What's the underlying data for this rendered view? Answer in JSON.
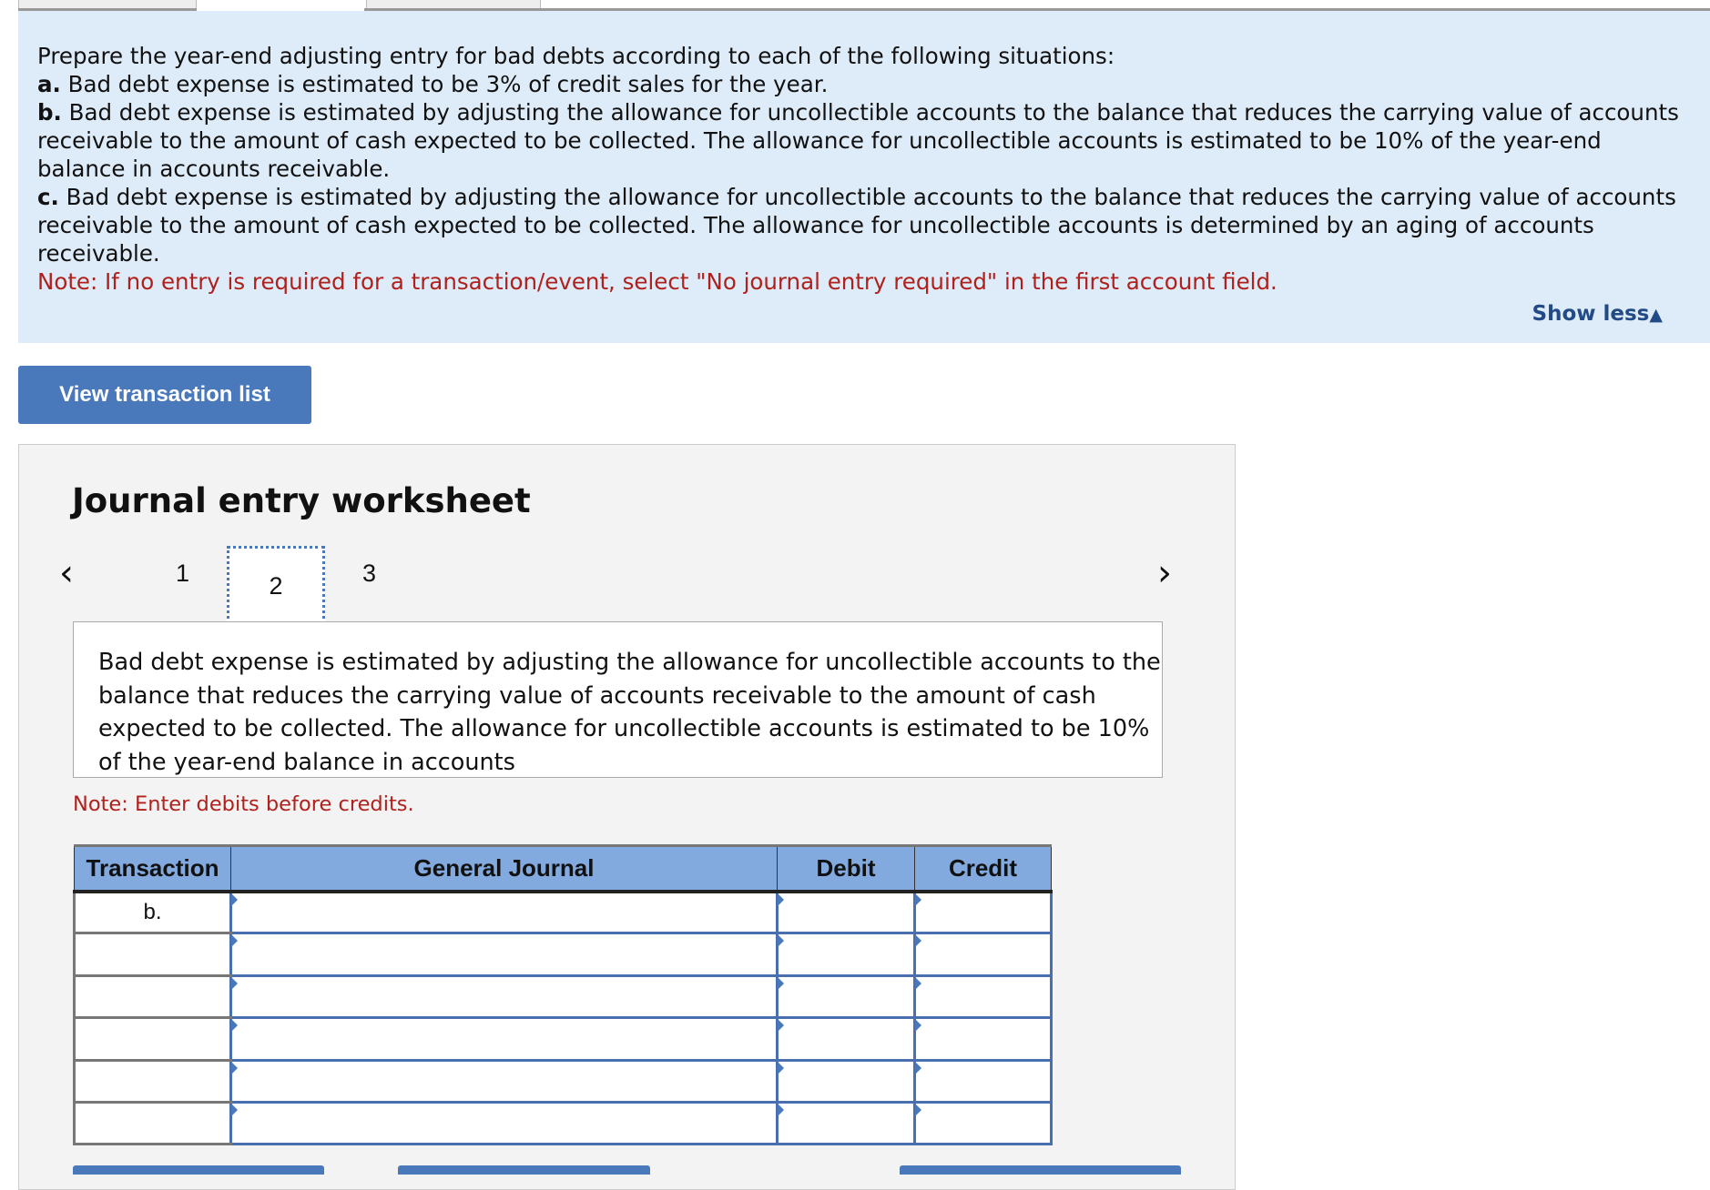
{
  "instructions": {
    "intro": "Prepare the year-end adjusting entry for bad debts according to each of the following situations:",
    "items": [
      {
        "label": "a.",
        "text": " Bad debt expense is estimated to be 3% of credit sales for the year."
      },
      {
        "label": "b.",
        "text": " Bad debt expense is estimated by adjusting the allowance for uncollectible accounts to the balance that reduces the carrying value of accounts receivable to the amount of cash expected to be collected. The allowance for uncollectible accounts is estimated to be 10% of the year-end balance in accounts receivable."
      },
      {
        "label": "c.",
        "text": " Bad debt expense is estimated by adjusting the allowance for uncollectible accounts to the balance that reduces the carrying value of accounts receivable to the amount of cash expected to be collected. The allowance for uncollectible accounts is determined by an aging of accounts receivable."
      }
    ],
    "note": "Note: If no entry is required for a transaction/event, select \"No journal entry required\" in the first account field.",
    "show_less": "Show less",
    "show_less_icon": "triangle-up-icon"
  },
  "view_transaction_list": "View transaction list",
  "worksheet": {
    "title": "Journal entry worksheet",
    "pages": [
      "1",
      "2",
      "3"
    ],
    "current_page": "2",
    "description": "Bad debt expense is estimated by adjusting the allowance for uncollectible accounts to the balance that reduces the carrying value of accounts receivable to the amount of cash expected to be collected. The allowance for uncollectible accounts is estimated to be 10% of the year-end balance in accounts",
    "note": "Note: Enter debits before credits.",
    "table": {
      "headers": [
        "Transaction",
        "General Journal",
        "Debit",
        "Credit"
      ],
      "rows": [
        {
          "transaction": "b.",
          "account": "",
          "debit": "",
          "credit": ""
        },
        {
          "transaction": "",
          "account": "",
          "debit": "",
          "credit": ""
        },
        {
          "transaction": "",
          "account": "",
          "debit": "",
          "credit": ""
        },
        {
          "transaction": "",
          "account": "",
          "debit": "",
          "credit": ""
        },
        {
          "transaction": "",
          "account": "",
          "debit": "",
          "credit": ""
        },
        {
          "transaction": "",
          "account": "",
          "debit": "",
          "credit": ""
        }
      ]
    }
  },
  "colors": {
    "panel": "#deebf8",
    "button": "#4a79bb",
    "note": "#b0201c",
    "header": "#82aadf"
  }
}
